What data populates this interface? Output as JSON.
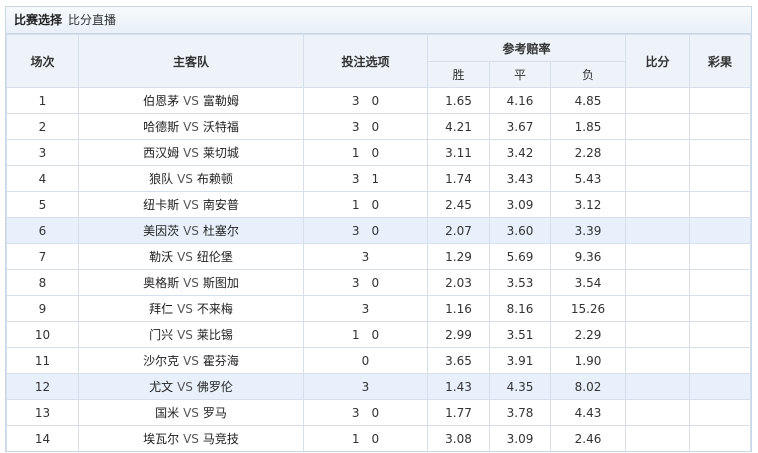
{
  "title": {
    "bold": "比赛选择",
    "sub": "比分直播"
  },
  "headers": {
    "index": "场次",
    "teams": "主客队",
    "options": "投注选项",
    "odds": "参考赔率",
    "win": "胜",
    "draw": "平",
    "loss": "负",
    "score": "比分",
    "result": "彩果"
  },
  "vs": "VS",
  "rows": [
    {
      "no": "1",
      "home": "伯恩茅",
      "away": "富勒姆",
      "opts": [
        "3",
        "0"
      ],
      "win": "1.65",
      "draw": "4.16",
      "loss": "4.85",
      "score": "",
      "result": ""
    },
    {
      "no": "2",
      "home": "哈德斯",
      "away": "沃特福",
      "opts": [
        "3",
        "0"
      ],
      "win": "4.21",
      "draw": "3.67",
      "loss": "1.85",
      "score": "",
      "result": ""
    },
    {
      "no": "3",
      "home": "西汉姆",
      "away": "莱切城",
      "opts": [
        "1",
        "0"
      ],
      "win": "3.11",
      "draw": "3.42",
      "loss": "2.28",
      "score": "",
      "result": ""
    },
    {
      "no": "4",
      "home": "狼队",
      "away": "布赖顿",
      "opts": [
        "3",
        "1"
      ],
      "win": "1.74",
      "draw": "3.43",
      "loss": "5.43",
      "score": "",
      "result": ""
    },
    {
      "no": "5",
      "home": "纽卡斯",
      "away": "南安普",
      "opts": [
        "1",
        "0"
      ],
      "win": "2.45",
      "draw": "3.09",
      "loss": "3.12",
      "score": "",
      "result": ""
    },
    {
      "no": "6",
      "home": "美因茨",
      "away": "杜塞尔",
      "opts": [
        "3",
        "0"
      ],
      "win": "2.07",
      "draw": "3.60",
      "loss": "3.39",
      "score": "",
      "result": "",
      "highlight": true
    },
    {
      "no": "7",
      "home": "勒沃",
      "away": "纽伦堡",
      "opts": [
        "3"
      ],
      "win": "1.29",
      "draw": "5.69",
      "loss": "9.36",
      "score": "",
      "result": ""
    },
    {
      "no": "8",
      "home": "奥格斯",
      "away": "斯图加",
      "opts": [
        "3",
        "0"
      ],
      "win": "2.03",
      "draw": "3.53",
      "loss": "3.54",
      "score": "",
      "result": ""
    },
    {
      "no": "9",
      "home": "拜仁",
      "away": "不来梅",
      "opts": [
        "3"
      ],
      "win": "1.16",
      "draw": "8.16",
      "loss": "15.26",
      "score": "",
      "result": ""
    },
    {
      "no": "10",
      "home": "门兴",
      "away": "莱比锡",
      "opts": [
        "1",
        "0"
      ],
      "win": "2.99",
      "draw": "3.51",
      "loss": "2.29",
      "score": "",
      "result": ""
    },
    {
      "no": "11",
      "home": "沙尔克",
      "away": "霍芬海",
      "opts": [
        "0"
      ],
      "win": "3.65",
      "draw": "3.91",
      "loss": "1.90",
      "score": "",
      "result": ""
    },
    {
      "no": "12",
      "home": "尤文",
      "away": "佛罗伦",
      "opts": [
        "3"
      ],
      "win": "1.43",
      "draw": "4.35",
      "loss": "8.02",
      "score": "",
      "result": "",
      "highlight": true
    },
    {
      "no": "13",
      "home": "国米",
      "away": "罗马",
      "opts": [
        "3",
        "0"
      ],
      "win": "1.77",
      "draw": "3.78",
      "loss": "4.43",
      "score": "",
      "result": ""
    },
    {
      "no": "14",
      "home": "埃瓦尔",
      "away": "马竞技",
      "opts": [
        "1",
        "0"
      ],
      "win": "3.08",
      "draw": "3.09",
      "loss": "2.46",
      "score": "",
      "result": ""
    }
  ]
}
